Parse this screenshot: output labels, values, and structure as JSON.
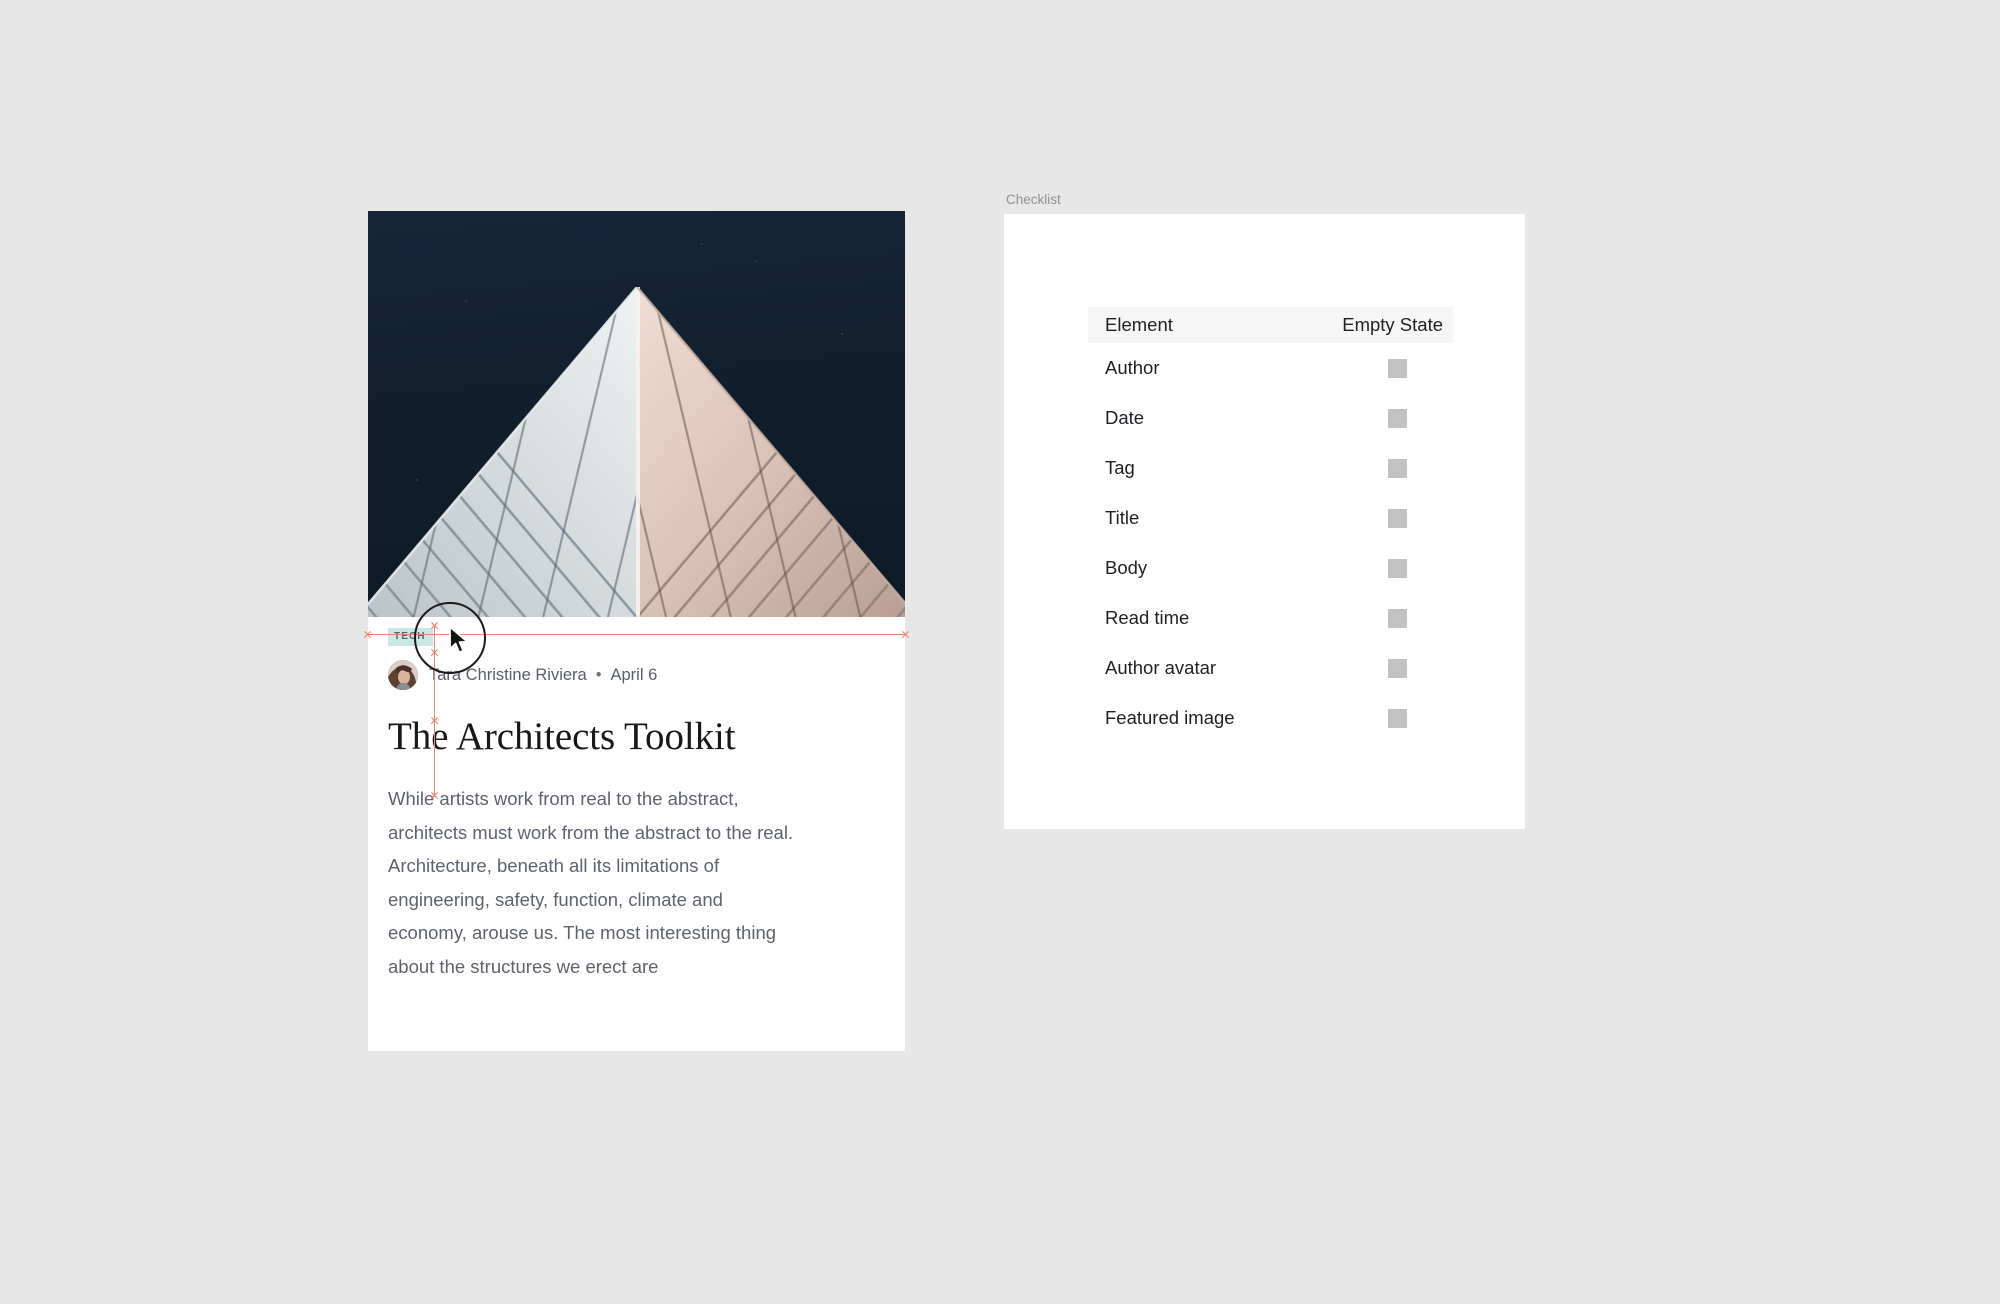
{
  "canvas": {
    "background": "#e7e7e7"
  },
  "article_card": {
    "tag": "TECH",
    "tag_bg": "#c8e8e4",
    "author": "Tara Christine Riviera",
    "separator": "•",
    "date": "April 6",
    "title": "The Architects Toolkit",
    "body": "While artists work from real to the abstract, architects must work from the abstract to the real. Architecture, beneath all its limitations of engineering, safety, function, climate and economy, arouse us. The most interesting thing about the structures we erect are",
    "hero_alt": "featured-image-building-peak"
  },
  "checklist": {
    "label": "Checklist",
    "columns": [
      "Element",
      "Empty State"
    ],
    "rows": [
      {
        "element": "Author",
        "empty_state": ""
      },
      {
        "element": "Date",
        "empty_state": ""
      },
      {
        "element": "Tag",
        "empty_state": ""
      },
      {
        "element": "Title",
        "empty_state": ""
      },
      {
        "element": "Body",
        "empty_state": ""
      },
      {
        "element": "Read time",
        "empty_state": ""
      },
      {
        "element": "Author avatar",
        "empty_state": ""
      },
      {
        "element": "Featured image",
        "empty_state": ""
      }
    ]
  },
  "guides": {
    "color": "#f0816a"
  }
}
